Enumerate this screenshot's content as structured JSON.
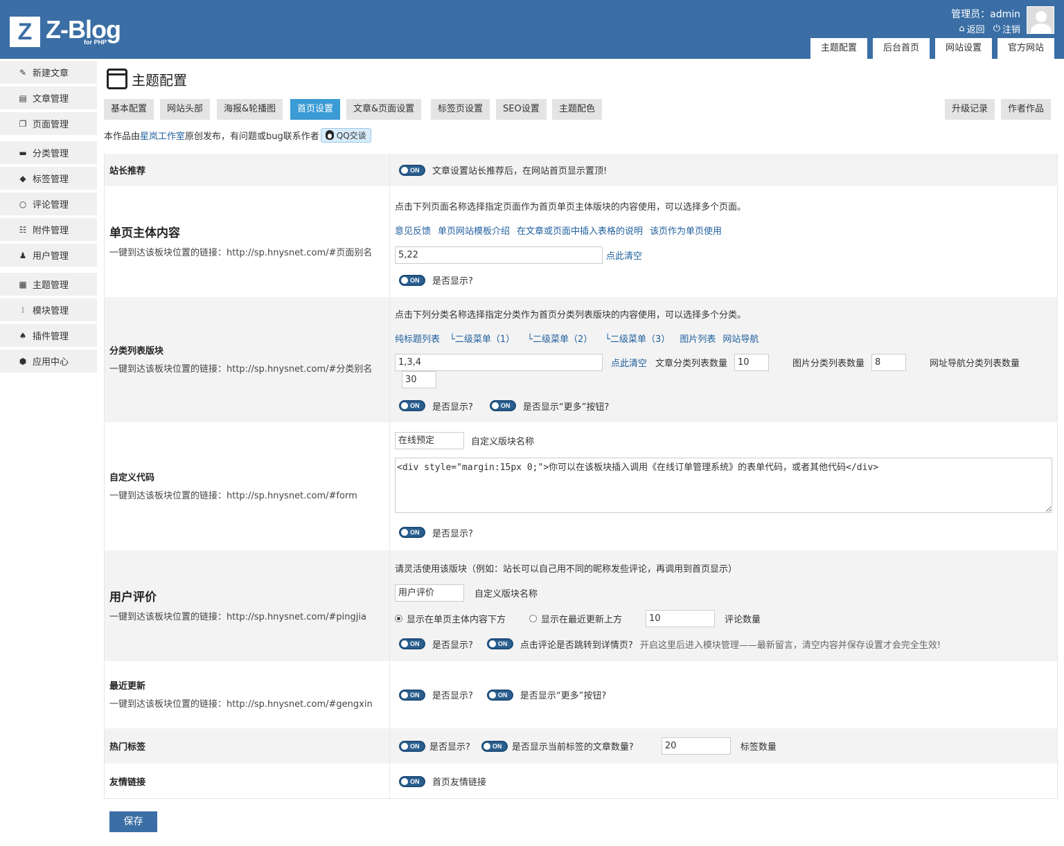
{
  "header": {
    "logo_letter": "Z",
    "logo_text": "Z-Blog",
    "logo_sub": "for PHP",
    "user_label": "管理员：admin",
    "back_label": "返回",
    "logout_label": "注销",
    "top_tabs": [
      "主题配置",
      "后台首页",
      "网站设置",
      "官方网站"
    ]
  },
  "sidebar": {
    "items": [
      {
        "label": "新建文章",
        "icon": "edit-icon"
      },
      {
        "label": "文章管理",
        "icon": "article-icon"
      },
      {
        "label": "页面管理",
        "icon": "page-icon"
      },
      {
        "label": "分类管理",
        "icon": "folder-icon"
      },
      {
        "label": "标签管理",
        "icon": "tag-icon"
      },
      {
        "label": "评论管理",
        "icon": "comment-icon"
      },
      {
        "label": "附件管理",
        "icon": "attachment-icon"
      },
      {
        "label": "用户管理",
        "icon": "user-icon"
      },
      {
        "label": "主题管理",
        "icon": "theme-icon"
      },
      {
        "label": "模块管理",
        "icon": "module-icon"
      },
      {
        "label": "插件管理",
        "icon": "plugin-icon"
      },
      {
        "label": "应用中心",
        "icon": "app-center-icon"
      }
    ]
  },
  "main": {
    "title": "主题配置",
    "tabs": [
      "基本配置",
      "网站头部",
      "海报&轮播图",
      "首页设置",
      "文章&页面设置",
      "标签页设置",
      "SEO设置",
      "主题配色"
    ],
    "right_tabs": [
      "升级记录",
      "作者作品"
    ],
    "active_tab": "首页设置",
    "notice_prefix": "本作品由",
    "notice_link": "星岚工作室",
    "notice_suffix": "原创发布，有问题或bug联系作者",
    "qq_label": "QQ交谈",
    "toggle_label": "ON"
  },
  "rows": {
    "zhanzhang": {
      "title": "站长推荐",
      "desc": "文章设置站长推荐后，在网站首页显示置顶!"
    },
    "danye": {
      "title": "单页主体内容",
      "link": "一键到达该板块位置的链接：http://sp.hnysnet.com/#页面别名",
      "hint": "点击下列页面名称选择指定页面作为首页单页主体版块的内容使用，可以选择多个页面。",
      "pages": [
        "意见反馈",
        "单页网站模板介绍",
        "在文章或页面中插入表格的说明",
        "该页作为单页使用"
      ],
      "value": "5,22",
      "clear": "点此清空",
      "show": "是否显示?"
    },
    "fenlei": {
      "title": "分类列表版块",
      "link": "一键到达该板块位置的链接：http://sp.hnysnet.com/#分类别名",
      "hint": "点击下列分类名称选择指定分类作为首页分类列表版块的内容使用，可以选择多个分类。",
      "cats": [
        "纯标题列表",
        "└二级菜单（1）",
        "└二级菜单（2）",
        "└二级菜单（3）",
        "图片列表",
        "网站导航"
      ],
      "value": "1,3,4",
      "clear": "点此清空",
      "article_count_label": "文章分类列表数量",
      "article_count": "10",
      "image_count_label": "图片分类列表数量",
      "image_count": "8",
      "nav_count_label": "网址导航分类列表数量",
      "nav_count": "30",
      "show": "是否显示?",
      "show_more": "是否显示“更多”按钮?"
    },
    "zidingyi": {
      "title": "自定义代码",
      "link": "一键到达该板块位置的链接：http://sp.hnysnet.com/#form",
      "name_value": "在线预定",
      "name_label": "自定义版块名称",
      "code": "<div style=\"margin:15px 0;\">你可以在该板块插入调用《在线订单管理系统》的表单代码，或者其他代码</div>",
      "show": "是否显示?"
    },
    "pingjia": {
      "title": "用户评价",
      "link": "一键到达该板块位置的链接：http://sp.hnysnet.com/#pingjia",
      "hint": "请灵活使用该版块（例如：站长可以自己用不同的昵称发些评论，再调用到首页显示）",
      "name_value": "用户评价",
      "name_label": "自定义版块名称",
      "radio1": "显示在单页主体内容下方",
      "radio2": "显示在最近更新上方",
      "count": "10",
      "count_label": "评论数量",
      "show": "是否显示?",
      "jump": "点击评论是否跳转到详情页?",
      "jump_note": "开启这里后进入模块管理——最新留言，清空内容并保存设置才会完全生效!"
    },
    "zuijin": {
      "title": "最近更新",
      "link": "一键到达该板块位置的链接：http://sp.hnysnet.com/#gengxin",
      "show": "是否显示?",
      "show_more": "是否显示“更多”按钮?"
    },
    "remen": {
      "title": "热门标签",
      "show": "是否显示?",
      "show_count": "是否显示当前标签的文章数量?",
      "count": "20",
      "count_label": "标签数量"
    },
    "youqing": {
      "title": "友情链接",
      "desc": "首页友情链接"
    }
  },
  "save_label": "保存"
}
